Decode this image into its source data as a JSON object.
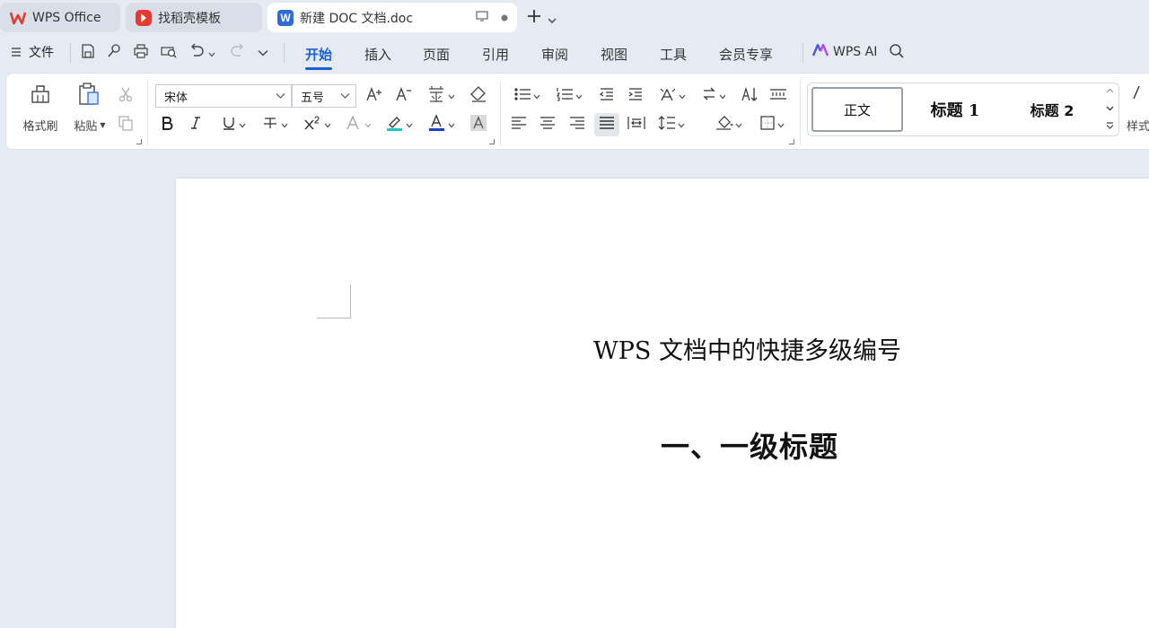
{
  "tabs": [
    {
      "label": "WPS Office",
      "icon": "wps-logo-icon"
    },
    {
      "label": "找稻壳模板",
      "icon": "docer-icon"
    },
    {
      "label": "新建 DOC 文档.doc",
      "icon": "word-doc-icon"
    }
  ],
  "menu": {
    "file_label": "文件",
    "tabs": [
      "开始",
      "插入",
      "页面",
      "引用",
      "审阅",
      "视图",
      "工具",
      "会员专享"
    ],
    "active_tab": "开始",
    "wps_ai_label": "WPS AI"
  },
  "ribbon": {
    "format_painter_label": "格式刷",
    "paste_label": "粘贴",
    "font_name": "宋体",
    "font_size": "五号",
    "styles": [
      "正文",
      "标题 1",
      "标题 2"
    ],
    "styles_panel_label": "样式"
  },
  "document": {
    "title": "WPS 文档中的快捷多级编号",
    "heading1": "一、一级标题"
  },
  "colors": {
    "accent": "#1a5fd8",
    "highlight": "#22c3c3",
    "font_color": "#1f3fbf",
    "wps_red": "#e8382f"
  }
}
